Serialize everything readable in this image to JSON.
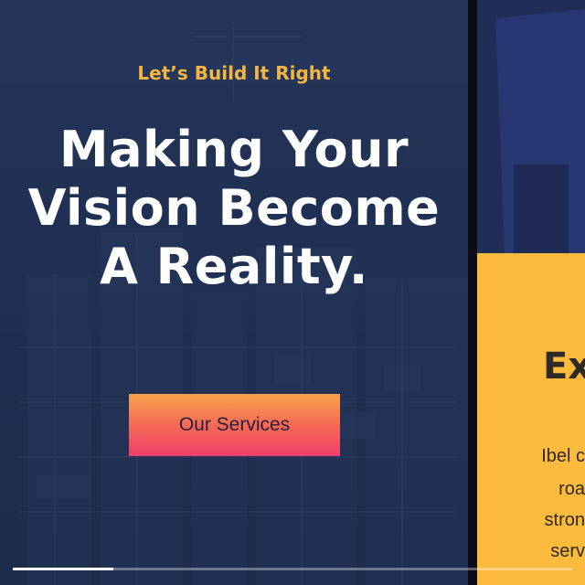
{
  "hero": {
    "eyebrow": "Let’s Build It Right",
    "headline_lines": [
      "Making Your",
      "Vision Become",
      "A Reality."
    ],
    "cta_label": "Our Services"
  },
  "side_slide": {
    "heading_partial": "Ex",
    "body_partial_lines": [
      "Ibel c",
      "roa",
      "stron",
      "serv"
    ]
  },
  "slider": {
    "progress": 0.18
  },
  "colors": {
    "accent": "#f5b541",
    "panel_yellow": "#fdbb3d",
    "hero_navy": "#24355a",
    "cta_top": "#f9a14a",
    "cta_bottom": "#ef3f6c"
  }
}
